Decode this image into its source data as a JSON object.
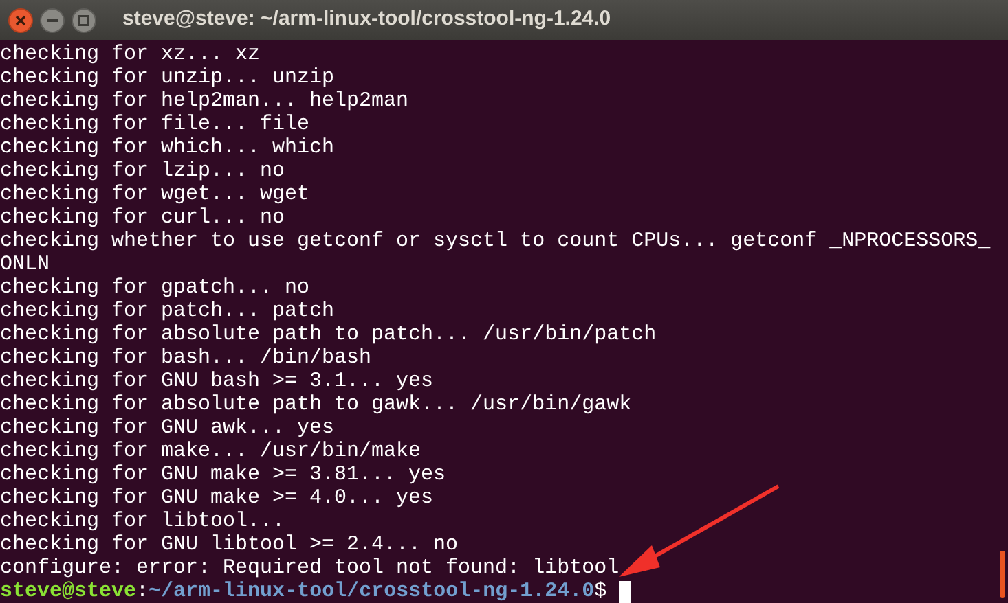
{
  "window": {
    "title": "steve@steve: ~/arm-linux-tool/crosstool-ng-1.24.0"
  },
  "terminal": {
    "lines": [
      "checking for xz... xz",
      "checking for unzip... unzip",
      "checking for help2man... help2man",
      "checking for file... file",
      "checking for which... which",
      "checking for lzip... no",
      "checking for wget... wget",
      "checking for curl... no",
      "checking whether to use getconf or sysctl to count CPUs... getconf _NPROCESSORS_",
      "ONLN",
      "checking for gpatch... no",
      "checking for patch... patch",
      "checking for absolute path to patch... /usr/bin/patch",
      "checking for bash... /bin/bash",
      "checking for GNU bash >= 3.1... yes",
      "checking for absolute path to gawk... /usr/bin/gawk",
      "checking for GNU awk... yes",
      "checking for make... /usr/bin/make",
      "checking for GNU make >= 3.81... yes",
      "checking for GNU make >= 4.0... yes",
      "checking for libtool...",
      "checking for GNU libtool >= 2.4... no",
      "configure: error: Required tool not found: libtool"
    ],
    "prompt": {
      "user_host": "steve@steve",
      "separator": ":",
      "path": "~/arm-linux-tool/crosstool-ng-1.24.0",
      "symbol": "$"
    }
  }
}
